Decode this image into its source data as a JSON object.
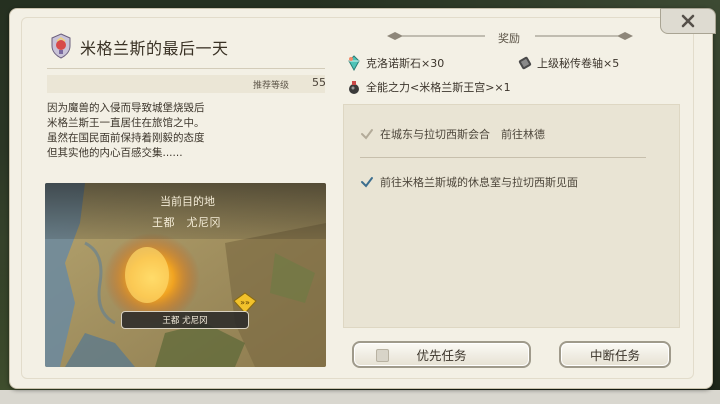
{
  "quest": {
    "title": "米格兰斯的最后一天",
    "level_label": "推荐等级",
    "level_value": "55",
    "description": "因为魔兽的入侵而导致城堡烧毁后\n米格兰斯王一直居住在旅馆之中。\n虽然在国民面前保持着刚毅的态度\n但其实他的内心百感交集......"
  },
  "map": {
    "destination_label": "当前目的地",
    "destination_name": "王都　尤尼冈",
    "place_tag": "王都 尤尼冈",
    "pin_glyph": "»»"
  },
  "rewards": {
    "title": "奖励",
    "items": [
      {
        "label": "克洛诺斯石×30",
        "icon": "crystal-icon"
      },
      {
        "label": "上级秘传卷轴×5",
        "icon": "scroll-icon"
      },
      {
        "label": "全能之力<米格兰斯王宫>×1",
        "icon": "potion-icon"
      }
    ]
  },
  "objectives": [
    {
      "text": "在城东与拉切西斯会合　前往林德",
      "state": "done"
    },
    {
      "text": "前往米格兰斯城的休息室与拉切西斯见面",
      "state": "active"
    }
  ],
  "buttons": {
    "priority": "优先任务",
    "abort": "中断任务"
  },
  "close_label": "×",
  "colors": {
    "panel": "#f3f0e5",
    "text": "#3a3225",
    "check_active": "#3c6e8f",
    "check_done": "#b3ab99"
  }
}
